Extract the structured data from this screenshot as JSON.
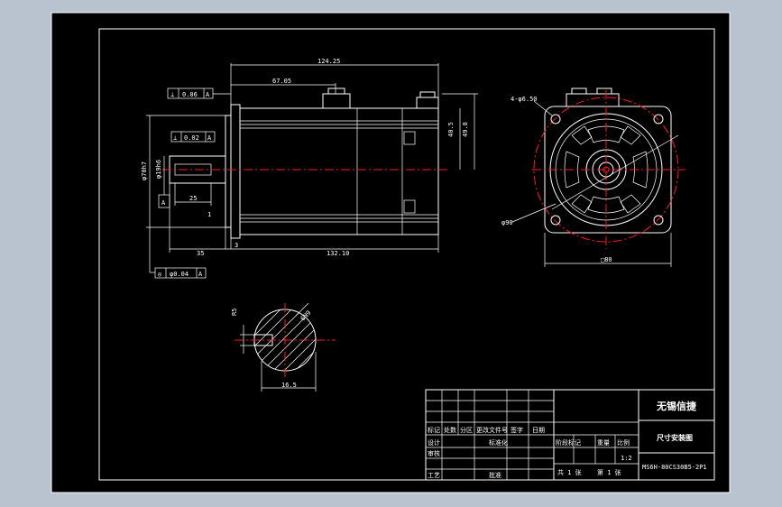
{
  "drawing": {
    "dimensions": {
      "overall_length": "124.25",
      "flange_to_connector": "67.05",
      "shaft_length": "35",
      "body_length": "132.10",
      "key_length": "25",
      "flange_step_1": "1",
      "flange_step_2": "3",
      "height_1": "49.8",
      "height_2": "40.5",
      "shaft_dia": "φ19h6",
      "pilot_dia": "φ70h7",
      "hole_dia": "4-φ6.50",
      "bolt_circle": "φ90",
      "flange_square": "□80",
      "key_width": "6N9",
      "key_depth": "16.5",
      "section_r": "R5"
    },
    "tolerances": {
      "perp": {
        "symbol": "⊥",
        "value": "0.06",
        "datum": "A"
      },
      "flat": {
        "symbol": "⊥",
        "value": "0.02",
        "datum": "A"
      },
      "conc": {
        "symbol": "◎",
        "value": "φ0.04",
        "datum": "A"
      },
      "datum_label": "A"
    },
    "title_block": {
      "company": "无锡信捷",
      "drawing_title": "尺寸安装图",
      "model": "MS6H-80CS30B5-2P1",
      "scale": "1:2",
      "col_mark": "标记",
      "col_count": "处数",
      "col_zone": "分区",
      "col_doc": "更改文件号",
      "col_sign": "签字",
      "col_date": "日期",
      "design": "设计",
      "standard": "标准化",
      "check": "审核",
      "process": "工艺",
      "approve": "批准",
      "stage_mark": "阶段标记",
      "weight": "重量",
      "ratio": "比例",
      "sheets_total": "共 1 张",
      "sheet_no": "第 1 张"
    }
  }
}
